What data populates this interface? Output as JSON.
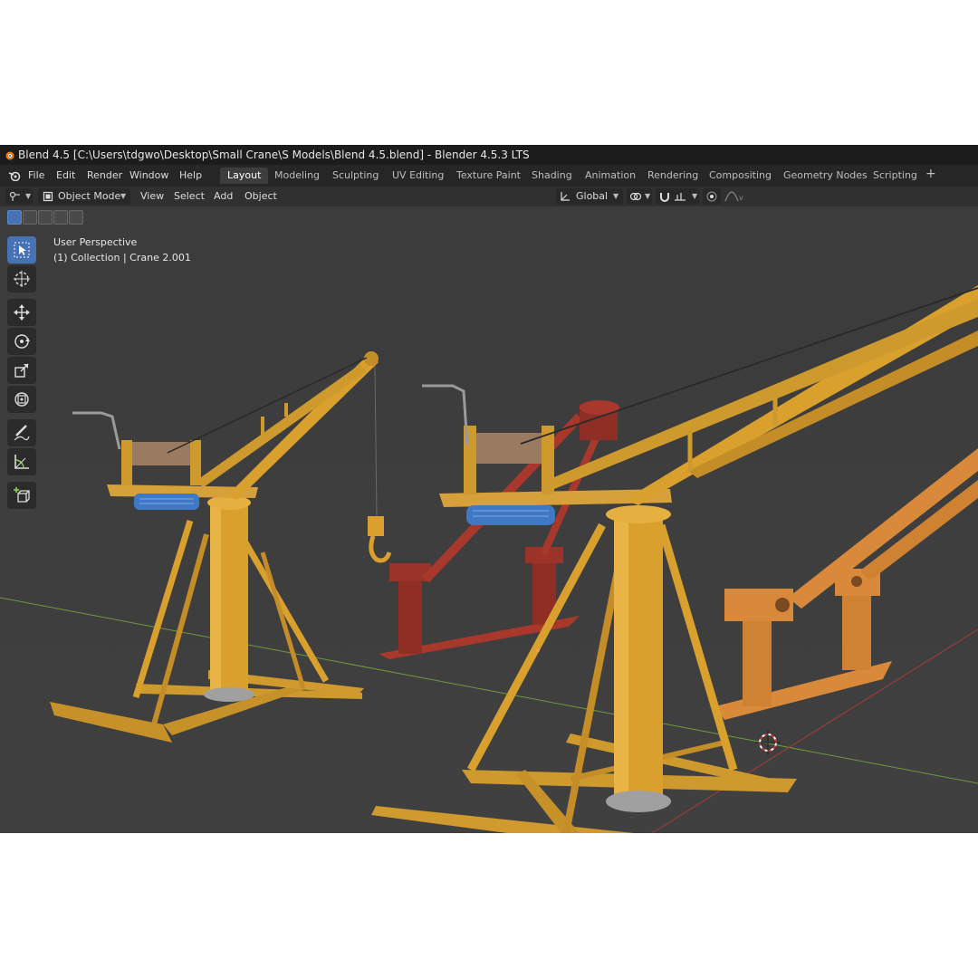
{
  "window": {
    "title": "Blend 4.5 [C:\\Users\\tdgwo\\Desktop\\Small Crane\\S Models\\Blend 4.5.blend] - Blender 4.5.3 LTS"
  },
  "menu": {
    "items": [
      "File",
      "Edit",
      "Render",
      "Window",
      "Help"
    ]
  },
  "workspaces": {
    "tabs": [
      "Layout",
      "Modeling",
      "Sculpting",
      "UV Editing",
      "Texture Paint",
      "Shading",
      "Animation",
      "Rendering",
      "Compositing",
      "Geometry Nodes",
      "Scripting"
    ],
    "active": "Layout"
  },
  "header": {
    "mode": "Object Mode",
    "menus": [
      "View",
      "Select",
      "Add",
      "Object"
    ],
    "transform_orientation": "Global"
  },
  "viewport": {
    "perspective_label": "User Perspective",
    "collection_label": "(1) Collection | Crane 2.001"
  },
  "toolbar": {
    "tools": [
      "select-box-icon",
      "cursor-icon",
      "move-icon",
      "rotate-icon",
      "scale-icon",
      "transform-icon",
      "annotate-icon",
      "measure-icon",
      "add-cube-icon"
    ],
    "active": "select-box-icon"
  },
  "colors": {
    "crane_yellow": "#d9a02e",
    "crane_red": "#a8372c",
    "crane_orange": "#d9893a",
    "drum_blue": "#3f78c4",
    "viewport_bg": "#3d3d3d",
    "x_axis": "#a83a3a",
    "y_axis": "#6f9a3c"
  }
}
